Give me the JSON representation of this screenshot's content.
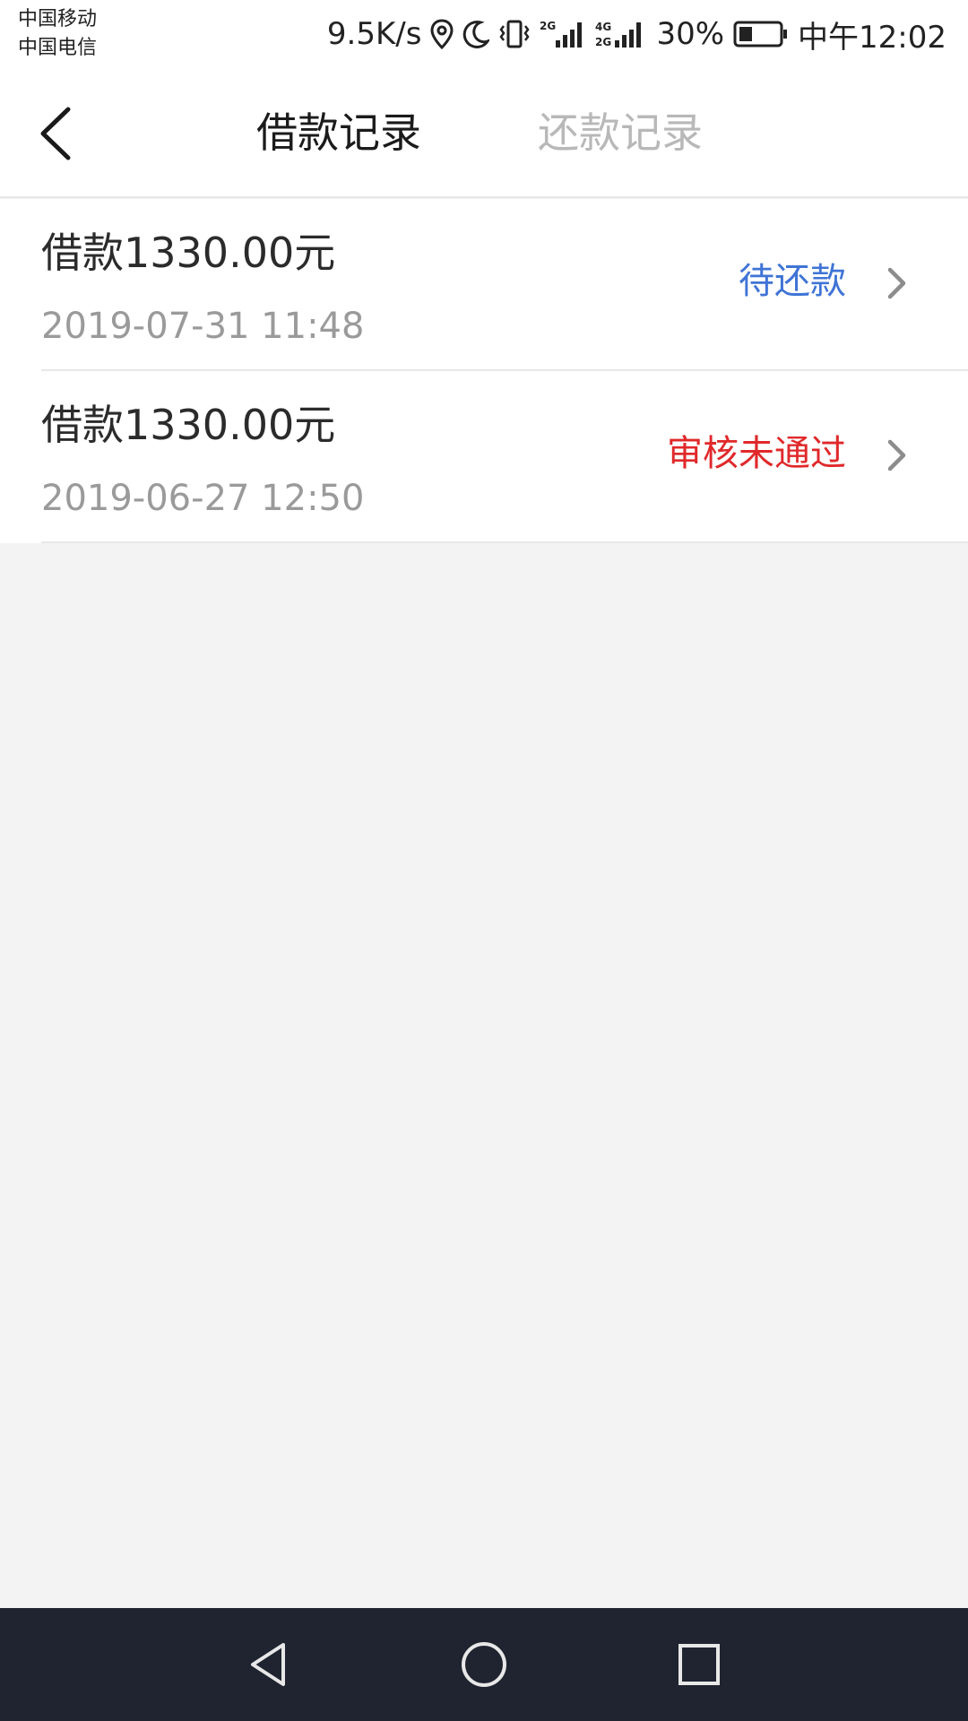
{
  "status_bar": {
    "carrier_1": "中国移动",
    "carrier_2": "中国电信",
    "net_speed": "9.5K/s",
    "battery": "30%",
    "time": "中午12:02",
    "icons": [
      "location-icon",
      "moon-icon",
      "vibrate-icon",
      "signal-2g-icon",
      "signal-4g-icon",
      "battery-icon"
    ]
  },
  "header": {
    "tabs": [
      {
        "label": "借款记录",
        "active": true
      },
      {
        "label": "还款记录",
        "active": false
      }
    ]
  },
  "records": [
    {
      "title": "借款1330.00元",
      "date": "2019-07-31 11:48",
      "status": "待还款",
      "status_color": "#3f74d6"
    },
    {
      "title": "借款1330.00元",
      "date": "2019-06-27 12:50",
      "status": "审核未通过",
      "status_color": "#e0282a"
    }
  ],
  "colors": {
    "background": "#f3f3f3",
    "nav_bar": "#1f2430",
    "inactive_tab": "#b8b8b8"
  }
}
